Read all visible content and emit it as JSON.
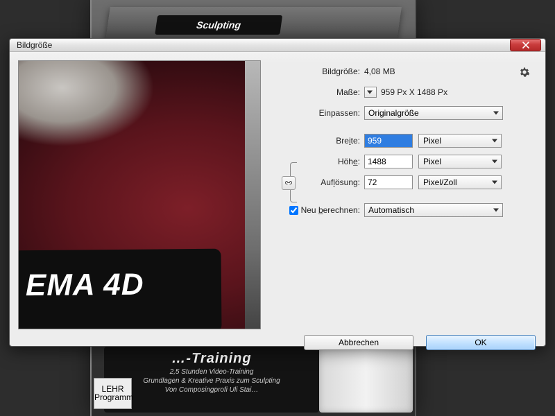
{
  "bg": {
    "top_label": "Sculpting",
    "bottom_title_partial": "…-Training",
    "bottom_line1": "2,5 Stunden Video-Training",
    "bottom_line2": "Grundlagen & Kreative Praxis zum Sculpting",
    "bottom_line3": "Von Composingprofi Uli Stai…",
    "lehr1": "LEHR",
    "lehr2": "Programm"
  },
  "preview_text": "EMA 4D",
  "dialog": {
    "title": "Bildgröße",
    "labels": {
      "image_size": "Bildgröße:",
      "dimensions": "Maße:",
      "fit_to": "Einpassen:",
      "width_html": "Bre<span class='underline-key'>i</span>te:",
      "height_html": "Höh<span class='underline-key'>e</span>:",
      "resolution_html": "Auf<span class='underline-key'>l</span>ösung:",
      "resample_html": "Neu <span class='underline-key'>b</span>erechnen:"
    },
    "values": {
      "image_size": "4,08 MB",
      "dimensions": "959 Px  X  1488 Px",
      "fit_to": "Originalgröße",
      "width": "959",
      "height": "1488",
      "resolution": "72",
      "unit_pixels": "Pixel",
      "unit_ppi": "Pixel/Zoll",
      "resample_checked": true,
      "resample_method": "Automatisch"
    },
    "buttons": {
      "cancel": "Abbrechen",
      "ok": "OK"
    }
  }
}
